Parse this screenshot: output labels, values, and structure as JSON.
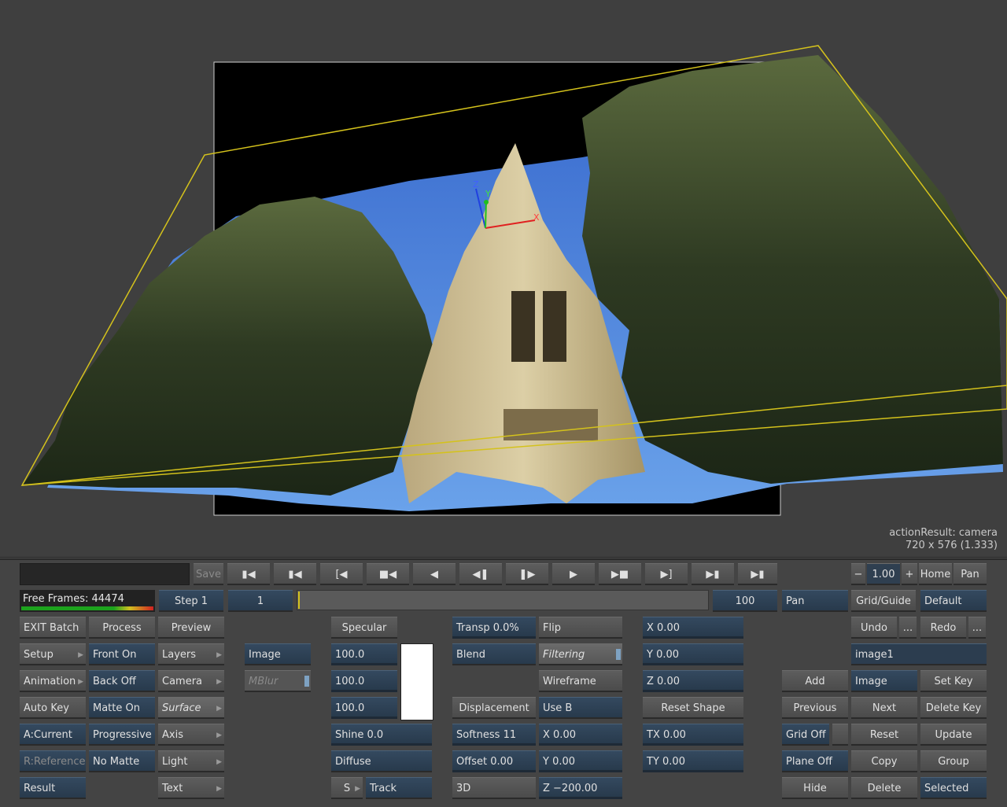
{
  "viewport": {
    "info_line1": "actionResult: camera",
    "info_line2": "720 x 576 (1.333)",
    "gizmo_labels": {
      "z": "Z",
      "y": "Y",
      "x": "X"
    }
  },
  "transport": {
    "save_label": "Save",
    "icons": [
      "first-frame-icon",
      "prev-key-icon",
      "prev-mark-icon",
      "rewind-icon",
      "play-reverse-icon",
      "step-back-icon",
      "step-forward-icon",
      "play-icon",
      "fast-forward-icon",
      "next-mark-icon",
      "next-key-icon",
      "last-frame-icon"
    ],
    "step_label": "Step 1",
    "current_frame": "1",
    "end_frame": "100",
    "free_frames": "Free Frames: 44474"
  },
  "view_controls": {
    "minus": "−",
    "zoom": "1.00",
    "plus": "+",
    "home": "Home",
    "pan_top": "Pan",
    "pan": "Pan",
    "grid_guide": "Grid/Guide",
    "default": "Default"
  },
  "col1": {
    "exit_batch": "EXIT Batch",
    "setup": "Setup",
    "animation": "Animation",
    "auto_key": "Auto Key",
    "a_current": "A:Current",
    "r_reference": "R:Reference",
    "result": "Result"
  },
  "col2": {
    "process": "Process",
    "front_on": "Front On",
    "back_off": "Back Off",
    "matte_on": "Matte On",
    "progressive": "Progressive",
    "no_matte": "No Matte"
  },
  "col3": {
    "preview": "Preview",
    "layers": "Layers",
    "camera": "Camera",
    "surface": "Surface",
    "axis": "Axis",
    "light": "Light",
    "text": "Text"
  },
  "surface": {
    "image": "Image",
    "mblur": "MBlur",
    "specular": "Specular",
    "spec_r": "100.0",
    "spec_g": "100.0",
    "spec_b": "100.0",
    "spec_color": "#ffffff",
    "shine": "Shine 0.0",
    "diffuse": "Diffuse",
    "s": "S",
    "track": "Track",
    "transp": "Transp 0.0%",
    "blend": "Blend",
    "displacement": "Displacement",
    "softness": "Softness 11",
    "offset": "Offset 0.00",
    "three_d": "3D",
    "flip": "Flip",
    "filtering": "Filtering",
    "wireframe": "Wireframe",
    "use_b": "Use B",
    "disp_x": "X 0.00",
    "disp_y": "Y 0.00",
    "disp_z": "Z −200.00",
    "x": "X 0.00",
    "y": "Y 0.00",
    "z": "Z 0.00",
    "reset_shape": "Reset Shape",
    "tx": "TX 0.00",
    "ty": "TY 0.00"
  },
  "keys": {
    "undo": "Undo",
    "more": "...",
    "redo": "Redo",
    "node_name": "image1",
    "add": "Add",
    "image": "Image",
    "set_key": "Set Key",
    "previous": "Previous",
    "next": "Next",
    "delete_key": "Delete Key",
    "grid_off": "Grid Off",
    "reset": "Reset",
    "update": "Update",
    "plane_off": "Plane Off",
    "copy": "Copy",
    "group": "Group",
    "hide": "Hide",
    "delete": "Delete",
    "selected": "Selected"
  }
}
